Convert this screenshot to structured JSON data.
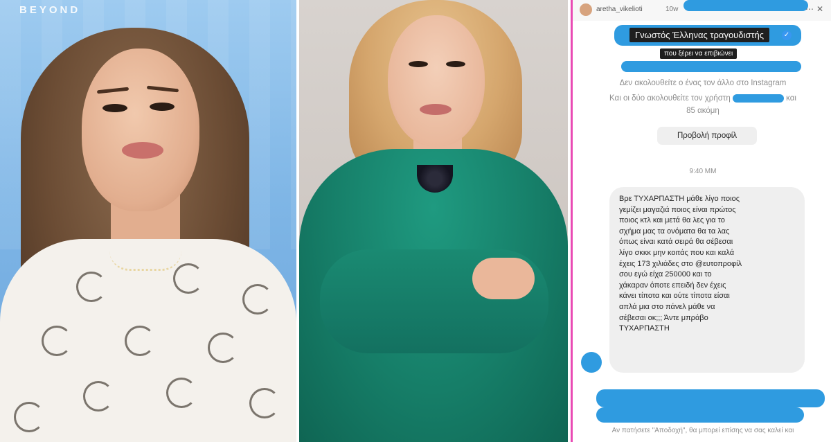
{
  "broadcast": {
    "logo": "BEYOND"
  },
  "dm": {
    "header": {
      "username": "aretha_vikelioti",
      "time": "10w",
      "menu_icon": "more-icon",
      "close_icon": "close-icon"
    },
    "caption_line1": "Γνωστός Έλληνας τραγουδιστής",
    "caption_line2": "που ξέρει να επιβιώνει",
    "not_following": "Δεν ακολουθείτε ο ένας τον άλλο στο Instagram",
    "mutual_followers_prefix": "Και οι δύο ακολουθείτε τον χρήστη",
    "mutual_followers_suffix": "και",
    "mutual_followers_more": "85 ακόμη",
    "view_profile_button": "Προβολή προφίλ",
    "timestamp": "9:40 ΜΜ",
    "message_lines": [
      "Βρε ΤΥΧΑΡΠΑΣΤΗ μάθε λίγο ποιος",
      "γεμίζει μαγαζιά ποιος είναι πρώτος",
      "ποιος κτλ και μετά θα λες για το",
      "σχήμα μας τα ονόματα θα τα λας",
      "όπως είναι κατά σειρά θα σέβεσαι",
      "λίγο σκκκ μην κοιτάς που και καλά",
      "έχεις 173 χιλιάδες στο @ευτοπροφίλ",
      "σου εγώ είχα 250000 και το",
      "χάκαραν όποτε επειδή δεν έχεις",
      "κάνει τίποτα και ούτε τίποτα είσαι",
      "απλά μια στο πάνελ μάθε να",
      "σέβεσαι οκ;;; Άντε μπράβο",
      "ΤΥΧΑΡΠΑΣΤΗ"
    ],
    "footer_line1": "Αν πατήσετε \"Αποδοχή\", θα μπορεί επίσης να σας καλεί και"
  }
}
